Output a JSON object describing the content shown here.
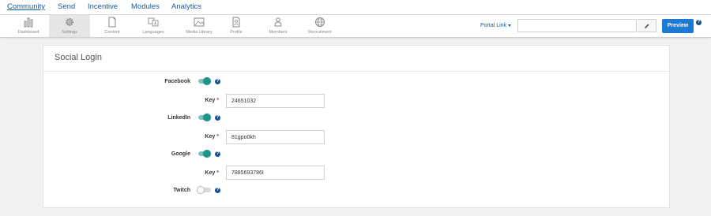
{
  "topnav": {
    "items": [
      {
        "label": "Community",
        "active": true
      },
      {
        "label": "Send"
      },
      {
        "label": "Incentive"
      },
      {
        "label": "Modules"
      },
      {
        "label": "Analytics"
      }
    ]
  },
  "toolbar": {
    "items": [
      {
        "label": "Dashboard",
        "icon": "bar-chart-icon"
      },
      {
        "label": "Settings",
        "icon": "gear-icon",
        "active": true
      },
      {
        "label": "Content",
        "icon": "document-icon"
      },
      {
        "label": "Languages",
        "icon": "translate-icon"
      },
      {
        "label": "Media Library",
        "icon": "image-icon"
      },
      {
        "label": "Profile",
        "icon": "profile-icon"
      },
      {
        "label": "Members",
        "icon": "members-icon"
      },
      {
        "label": "Recruitment",
        "icon": "globe-icon"
      }
    ],
    "portal_link_label": "Portal Link",
    "url_value": "",
    "preview_label": "Preview",
    "help_glyph": "?"
  },
  "card": {
    "title": "Social Login",
    "providers": [
      {
        "name": "Facebook",
        "enabled": true,
        "key_label": "Key",
        "key_required": "*",
        "key_value": "24651032"
      },
      {
        "name": "LinkedIn",
        "enabled": true,
        "key_label": "Key",
        "key_required": "*",
        "key_value": "81gpo0kh"
      },
      {
        "name": "Google",
        "enabled": true,
        "key_label": "Key",
        "key_required": "*",
        "key_value": "7885693786I"
      },
      {
        "name": "Twitch",
        "enabled": false
      }
    ]
  },
  "colors": {
    "link": "#1a5a96",
    "primary_button": "#1c7ad2",
    "toggle_on": "#1e9688",
    "required": "#d9272e"
  }
}
